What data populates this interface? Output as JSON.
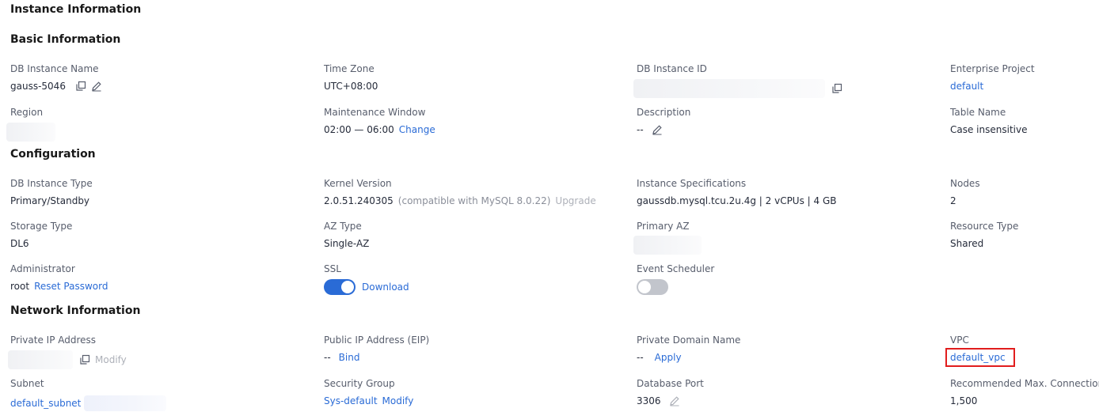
{
  "page": {
    "title": "Instance Information"
  },
  "basic": {
    "heading": "Basic Information",
    "db_instance_name": {
      "label": "DB Instance Name",
      "value": "gauss-5046"
    },
    "time_zone": {
      "label": "Time Zone",
      "value": "UTC+08:00"
    },
    "db_instance_id": {
      "label": "DB Instance ID"
    },
    "enterprise_project": {
      "label": "Enterprise Project",
      "value": "default"
    },
    "region": {
      "label": "Region"
    },
    "maintenance_window": {
      "label": "Maintenance Window",
      "value": "02:00 — 06:00",
      "action": "Change"
    },
    "description": {
      "label": "Description",
      "value": "--"
    },
    "table_name": {
      "label": "Table Name",
      "value": "Case insensitive"
    }
  },
  "config": {
    "heading": "Configuration",
    "db_instance_type": {
      "label": "DB Instance Type",
      "value": "Primary/Standby"
    },
    "kernel_version": {
      "label": "Kernel Version",
      "value": "2.0.51.240305",
      "note": "(compatible with MySQL 8.0.22)",
      "action": "Upgrade"
    },
    "instance_specs": {
      "label": "Instance Specifications",
      "value": "gaussdb.mysql.tcu.2u.4g | 2 vCPUs | 4 GB"
    },
    "nodes": {
      "label": "Nodes",
      "value": "2"
    },
    "storage_type": {
      "label": "Storage Type",
      "value": "DL6"
    },
    "az_type": {
      "label": "AZ Type",
      "value": "Single-AZ"
    },
    "primary_az": {
      "label": "Primary AZ"
    },
    "resource_type": {
      "label": "Resource Type",
      "value": "Shared"
    },
    "administrator": {
      "label": "Administrator",
      "value": "root",
      "action": "Reset Password"
    },
    "ssl": {
      "label": "SSL",
      "enabled": true,
      "action": "Download"
    },
    "event_scheduler": {
      "label": "Event Scheduler",
      "enabled": false
    }
  },
  "network": {
    "heading": "Network Information",
    "private_ip": {
      "label": "Private IP Address",
      "action": "Modify"
    },
    "public_ip": {
      "label": "Public IP Address (EIP)",
      "value": "--",
      "action": "Bind"
    },
    "private_domain": {
      "label": "Private Domain Name",
      "value": "--",
      "action": "Apply"
    },
    "vpc": {
      "label": "VPC",
      "value": "default_vpc"
    },
    "subnet": {
      "label": "Subnet",
      "value": "default_subnet"
    },
    "security_group": {
      "label": "Security Group",
      "value": "Sys-default",
      "action": "Modify"
    },
    "database_port": {
      "label": "Database Port",
      "value": "3306"
    },
    "max_connections": {
      "label": "Recommended Max. Connections",
      "value": "1,500"
    }
  },
  "colors": {
    "link": "#2a6bd6",
    "highlight": "#e11d1d",
    "toggle_on": "#2a6bd6",
    "toggle_off": "#c2c5cc"
  },
  "icons": [
    "copy-icon",
    "edit-icon"
  ]
}
